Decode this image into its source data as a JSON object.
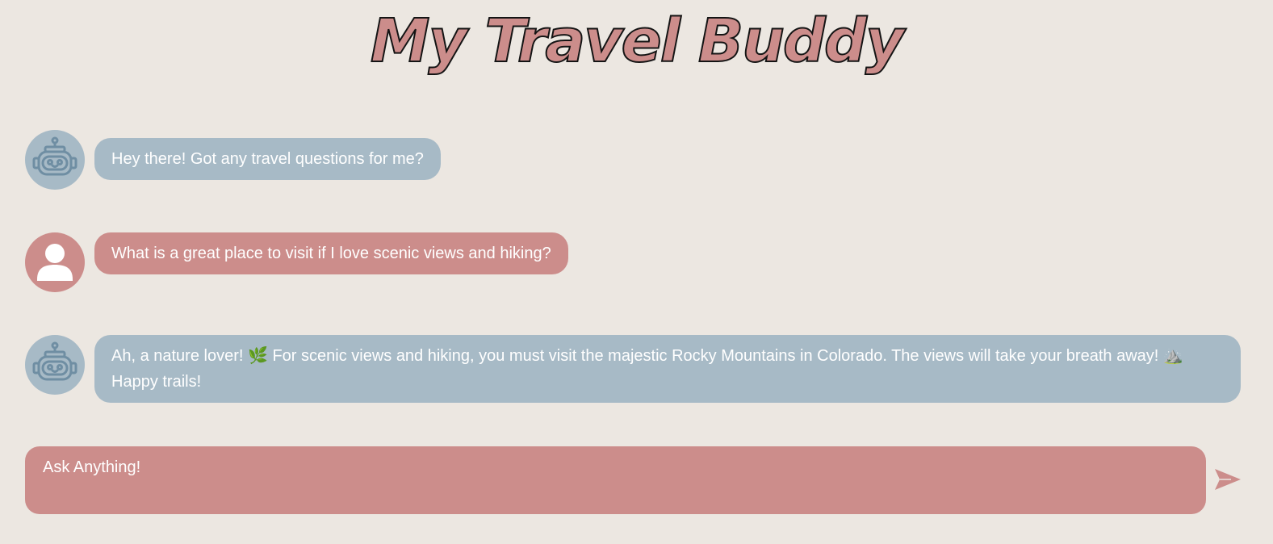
{
  "app": {
    "title": "My Travel Buddy"
  },
  "messages": [
    {
      "role": "bot",
      "avatar_icon": "robot-icon",
      "text": "Hey there! Got any travel questions for me?"
    },
    {
      "role": "user",
      "avatar_icon": "user-icon",
      "text": "What is a great place to visit if I love scenic views and hiking?"
    },
    {
      "role": "bot",
      "avatar_icon": "robot-icon",
      "text": "Ah, a nature lover! 🌿 For scenic views and hiking, you must visit the majestic Rocky Mountains in Colorado. The views will take your breath away! ⛰️ Happy trails!"
    }
  ],
  "composer": {
    "placeholder": "Ask Anything!",
    "value": "",
    "send_icon": "send-icon"
  },
  "colors": {
    "background": "#ece7e1",
    "accent": "#cc8d8b",
    "bot_bubble": "#a7bac6",
    "bot_icon": "#6f8ea3"
  }
}
